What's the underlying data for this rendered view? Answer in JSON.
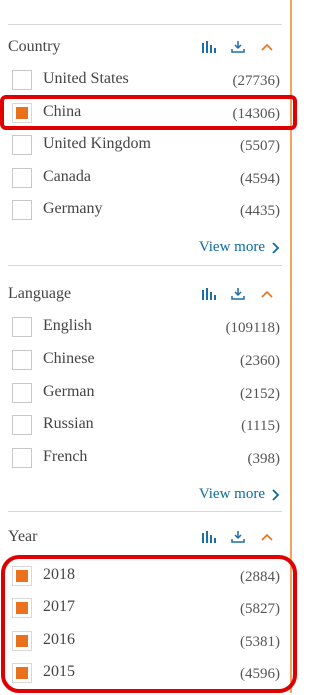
{
  "sidebar": {
    "sections": [
      {
        "title": "Country",
        "items": [
          {
            "label": "United States",
            "count": "(27736)",
            "checked": false
          },
          {
            "label": "China",
            "count": "(14306)",
            "checked": true
          },
          {
            "label": "United Kingdom",
            "count": "(5507)",
            "checked": false
          },
          {
            "label": "Canada",
            "count": "(4594)",
            "checked": false
          },
          {
            "label": "Germany",
            "count": "(4435)",
            "checked": false
          }
        ],
        "view_more": "View more"
      },
      {
        "title": "Language",
        "items": [
          {
            "label": "English",
            "count": "(109118)",
            "checked": false
          },
          {
            "label": "Chinese",
            "count": "(2360)",
            "checked": false
          },
          {
            "label": "German",
            "count": "(2152)",
            "checked": false
          },
          {
            "label": "Russian",
            "count": "(1115)",
            "checked": false
          },
          {
            "label": "French",
            "count": "(398)",
            "checked": false
          }
        ],
        "view_more": "View more"
      },
      {
        "title": "Year",
        "items": [
          {
            "label": "2018",
            "count": "(2884)",
            "checked": true
          },
          {
            "label": "2017",
            "count": "(5827)",
            "checked": true
          },
          {
            "label": "2016",
            "count": "(5381)",
            "checked": true
          },
          {
            "label": "2015",
            "count": "(4596)",
            "checked": true
          }
        ]
      }
    ]
  },
  "colors": {
    "accent": "#e9711c",
    "link": "#0c6a9f",
    "panel_border": "#f5a25d",
    "annotation": "#e00000"
  },
  "icons": [
    "analyze-bars-icon",
    "download-icon",
    "chevron-up-icon",
    "chevron-right-icon"
  ]
}
